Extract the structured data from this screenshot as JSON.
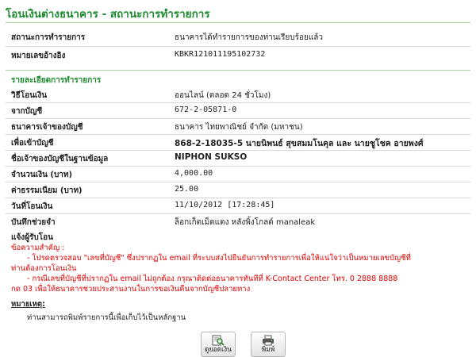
{
  "page": {
    "title": "โอนเงินต่างธนาคาร - สถานะการทำรายการ"
  },
  "status": {
    "label": "สถานะการทำรายการ",
    "value": "ธนาคารได้ทำรายการของท่านเรียบร้อยแล้ว"
  },
  "reference": {
    "label": "หมายเลขอ้างอิง",
    "value": "KBKR121011195102732"
  },
  "details": {
    "section_title": "รายละเอียดการทำรายการ",
    "rows": [
      {
        "label": "วิธีโอนเงิน",
        "value": "ออนไลน์ (ตลอด 24 ชั่วโมง)"
      },
      {
        "label": "จากบัญชี",
        "value": "672-2-05871-0"
      },
      {
        "label": "ธนาคารเจ้าของบัญชี",
        "value": "ธนาคาร ไทยพาณิชย์ จำกัด (มหาชน)"
      },
      {
        "label": "เพื่อเข้าบัญชี",
        "value": "868-2-18035-5 นายนิพนธ์ สุขสมมโนคุล และ นายชูโชค อายพงศ์"
      },
      {
        "label": "ชื่อเจ้าของบัญชีในฐานข้อมูล",
        "value": "NIPHON SUKSO"
      },
      {
        "label": "จำนวนเงิน (บาท)",
        "value": "4,000.00"
      },
      {
        "label": "ค่าธรรมเนียม (บาท)",
        "value": "25.00"
      },
      {
        "label": "วันที่โอนเงิน",
        "value": "11/10/2012 [17:28:45]"
      },
      {
        "label": "บันทึกช่วยจำ",
        "value": "ล็อกเก็ตเม็ดแตง หลังพิ้งโกลด์ manaleak"
      }
    ]
  },
  "notify": {
    "label": "แจ้งผู้รับโอน"
  },
  "warning": {
    "heading": "ข้อความสำคัญ :",
    "line1": "- โปรดตรวจสอบ \"เลขที่บัญชี\" ซึ่งปรากฏใน email ที่ระบบส่งไปยืนยันการทำรายการเพื่อให้แน่ใจว่าเป็นหมายเลขบัญชีที่",
    "line2": "ท่านต้องการโอนเงิน",
    "line3": "- กรณีเลขที่บัญชีที่ปรากฏใน email ไม่ถูกต้อง กรุณาติดต่อธนาคารทันทีที่ K-Contact Center โทร. 0 2888 8888",
    "line4": "กด 03 เพื่อให้ธนาคารช่วยประสานงานในการขอเงินคืนจากบัญชีปลายทาง"
  },
  "remark": {
    "label": "หมายเหตุ:",
    "text": "ท่านสามารถพิมพ์รายการนี้เพื่อเก็บไว้เป็นหลักฐาน"
  },
  "buttons": {
    "view_balance": "ดูยอดเงิน",
    "print": "พิมพ์"
  },
  "colors": {
    "accent": "#1b8a2e",
    "warning": "#e00000"
  },
  "icons": {
    "view_balance": "magnifier-document-icon",
    "print": "printer-icon"
  }
}
